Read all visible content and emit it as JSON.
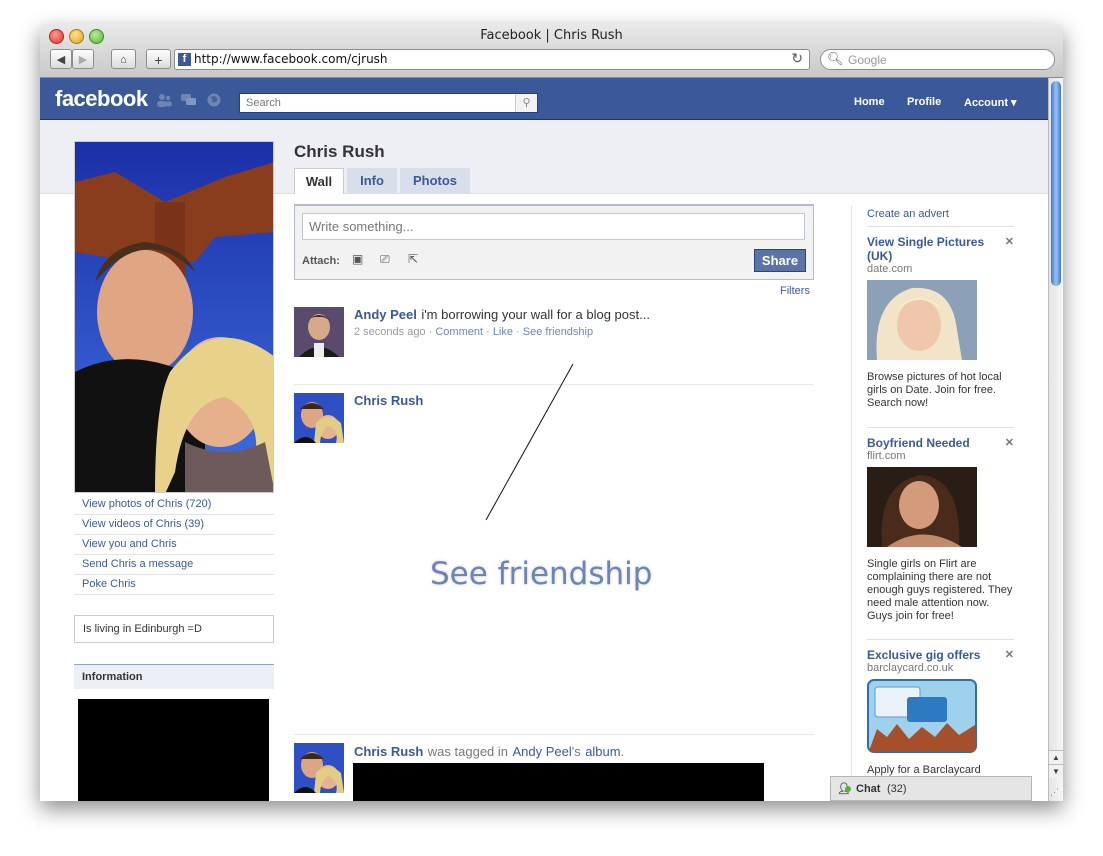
{
  "browser": {
    "title": "Facebook | Chris Rush",
    "url": "http://www.facebook.com/cjrush",
    "search_placeholder": "Google"
  },
  "fb": {
    "logo": "facebook",
    "search_placeholder": "Search",
    "nav": {
      "home": "Home",
      "profile": "Profile",
      "account": "Account ▾"
    }
  },
  "profile": {
    "name": "Chris Rush",
    "tabs": [
      "Wall",
      "Info",
      "Photos"
    ],
    "sidelinks": [
      "View photos of Chris (720)",
      "View videos of Chris (39)",
      "View you and Chris",
      "Send Chris a message",
      "Poke Chris"
    ],
    "status": "Is living in Edinburgh =D",
    "info_heading": "Information"
  },
  "publisher": {
    "placeholder": "Write something...",
    "attach_label": "Attach:",
    "share_label": "Share",
    "filters": "Filters"
  },
  "stories": [
    {
      "actor": "Andy Peel",
      "message": "i'm borrowing your wall for a blog post...",
      "time": "2 seconds ago",
      "actions": [
        "Comment",
        "Like",
        "See friendship"
      ]
    },
    {
      "actor": "Chris Rush"
    },
    {
      "actor": "Chris Rush",
      "text1": "was tagged in",
      "link": "Andy Peel",
      "text2": "'s",
      "album": "album",
      "end": "."
    }
  ],
  "annotation": "See friendship",
  "ads": {
    "create": "Create an advert",
    "items": [
      {
        "title": "View Single Pictures (UK)",
        "domain": "date.com",
        "text": "Browse pictures of hot local girls on Date. Join for free. Search now!"
      },
      {
        "title": "Boyfriend Needed",
        "domain": "flirt.com",
        "text": "Single girls on Flirt are complaining there are not enough guys registered. They need male attention now. Guys join for free!"
      },
      {
        "title": "Exclusive gig offers",
        "domain": "barclaycard.co.uk",
        "text": "Apply for a Barclaycard"
      }
    ]
  },
  "chat": {
    "label": "Chat",
    "count": "(32)"
  },
  "colors": {
    "fb_blue": "#3b5998",
    "link": "#3b5998",
    "meta": "#999999"
  }
}
